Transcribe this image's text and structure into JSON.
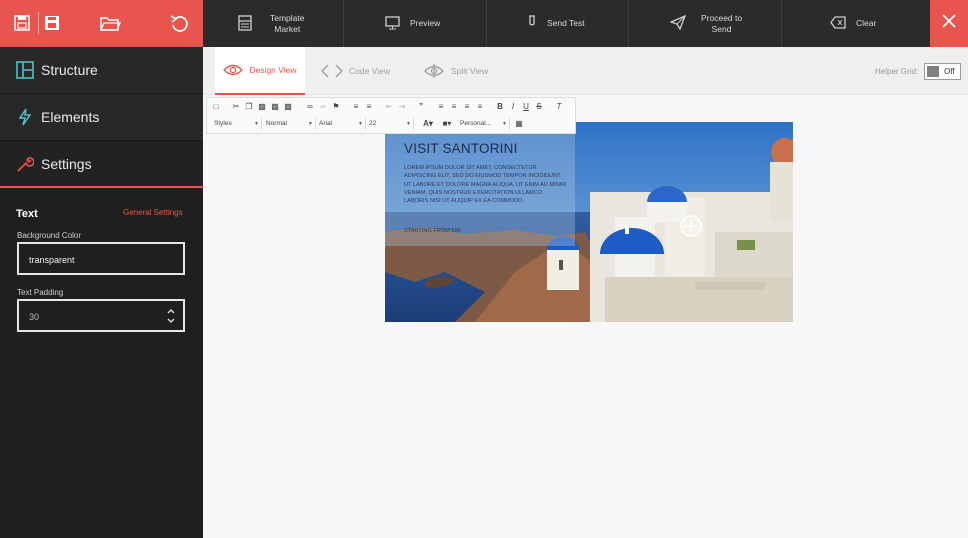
{
  "toolbar": {
    "actions": [
      {
        "id": "template-market",
        "label": "Template\nMarket",
        "icon": "template-market-icon"
      },
      {
        "id": "preview",
        "label": "Preview",
        "icon": "monitor-icon"
      },
      {
        "id": "send-test",
        "label": "Send Test",
        "icon": "beaker-icon"
      },
      {
        "id": "proceed-to-send",
        "label": "Proceed to\nSend",
        "icon": "paper-plane-icon"
      },
      {
        "id": "clear",
        "label": "Clear",
        "icon": "clear-icon"
      }
    ]
  },
  "sidebar": {
    "nav": [
      {
        "label": "Structure",
        "icon": "columns-icon"
      },
      {
        "label": "Elements",
        "icon": "lightning-icon"
      },
      {
        "label": "Settings",
        "icon": "wrench-icon"
      }
    ],
    "panel": {
      "title": "Text",
      "general_settings": "General Settings",
      "background_color_label": "Background Color",
      "background_color_value": "transparent",
      "text_padding_label": "Text Padding",
      "text_padding_value": "30"
    }
  },
  "view_tabs": {
    "design": "Design View",
    "code": "Code View",
    "split": "Split View"
  },
  "helper_grid": {
    "label": "Helper Grid:",
    "state": "Off"
  },
  "editor_toolbar": {
    "styles": "Styles",
    "format": "Normal",
    "font": "Arial",
    "size": "22",
    "personalize": "Personal..."
  },
  "hero": {
    "title": "VISIT SANTORINI",
    "body": "LOREM IPSUM DOLOR SIT AMET, CONSECTETUR ADIPISCING ELIT, SED DO EIUSMOD TEMPOR INCIDIDUNT UT LABORE ET DOLORE MAGNA ALIQUA. UT ENIM AD MINIM VENIAM, QUIS NOSTRUD EXERCITATION ULLAMCO LABORIS NISI UT ALIQUIP EX EA COMMODO.",
    "cta": "STARTING FROM $99"
  },
  "colors": {
    "accent": "#e8554e",
    "dark": "#2b2b2b",
    "sidebar": "#1f1f1f"
  }
}
